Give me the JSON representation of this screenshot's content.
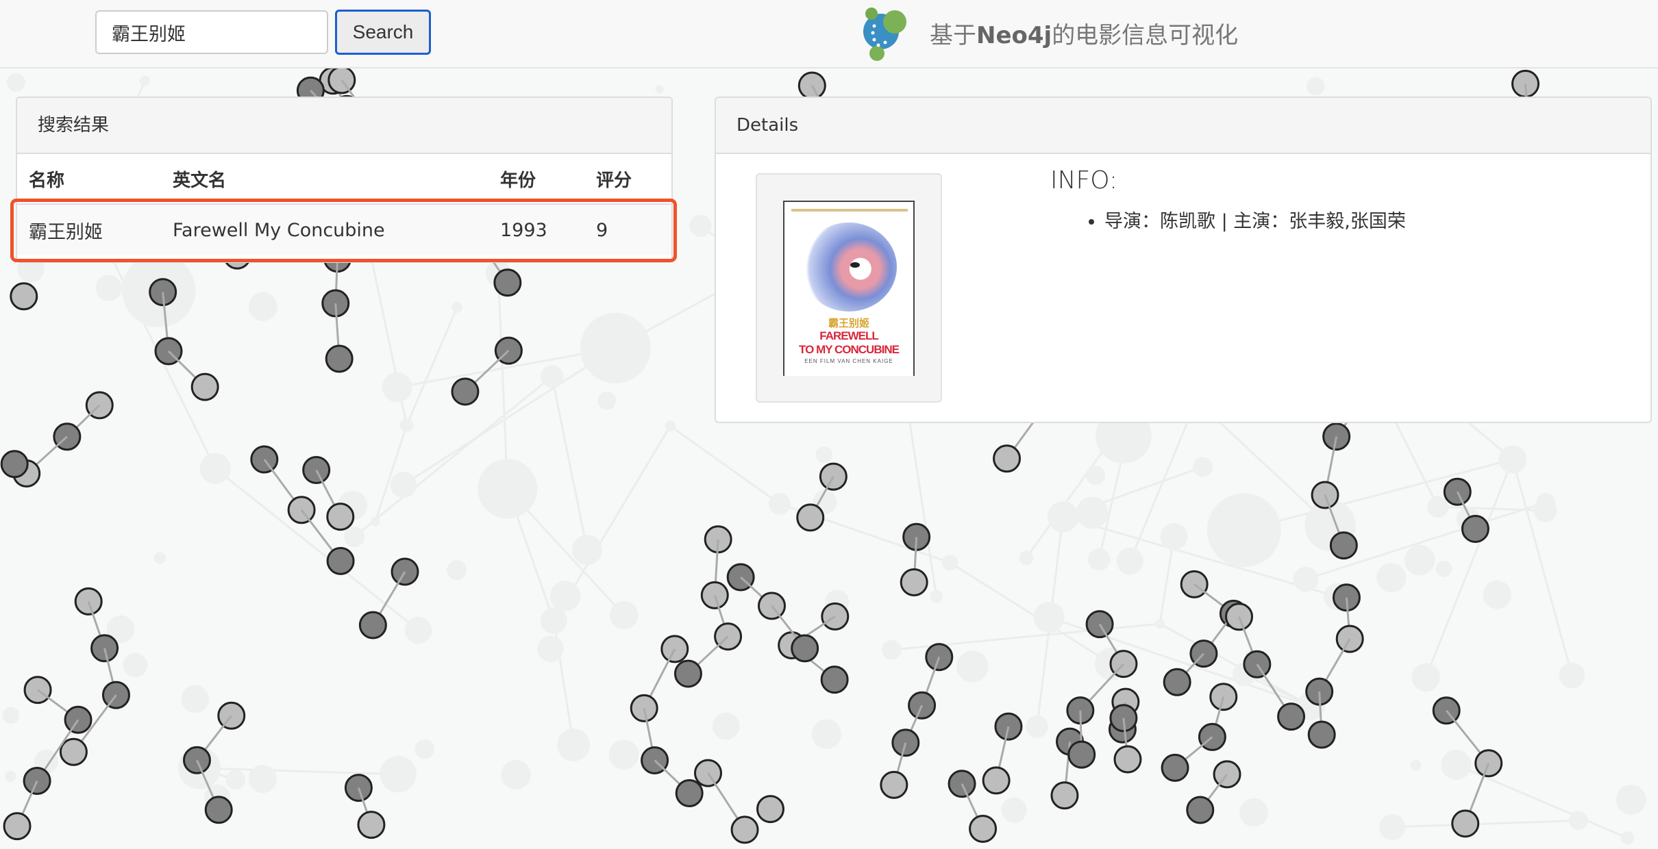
{
  "header": {
    "search_value": "霸王别姬",
    "search_button": "Search",
    "title_prefix": "基于",
    "title_brand": "Neo4j",
    "title_suffix": "的电影信息可视化",
    "logo_icon": "neo4j-logo",
    "accent": "#1a5fd0"
  },
  "results": {
    "heading": "搜索结果",
    "columns": [
      "名称",
      "英文名",
      "年份",
      "评分"
    ],
    "rows": [
      {
        "name": "霸王别姬",
        "english": "Farewell My Concubine",
        "year": "1993",
        "rating": "9"
      }
    ],
    "highlight_color": "#f0522a"
  },
  "details": {
    "heading": "Details",
    "info_title": "INFO:",
    "info_items": [
      "导演：陈凯歌 | 主演：张丰毅,张国荣"
    ],
    "poster": {
      "title_cn": "霸王别姬",
      "title_en_1": "FAREWELL",
      "title_en_2": "TO MY CONCUBINE",
      "subtitle": "EEN FILM VAN CHEN KAIGE"
    }
  }
}
